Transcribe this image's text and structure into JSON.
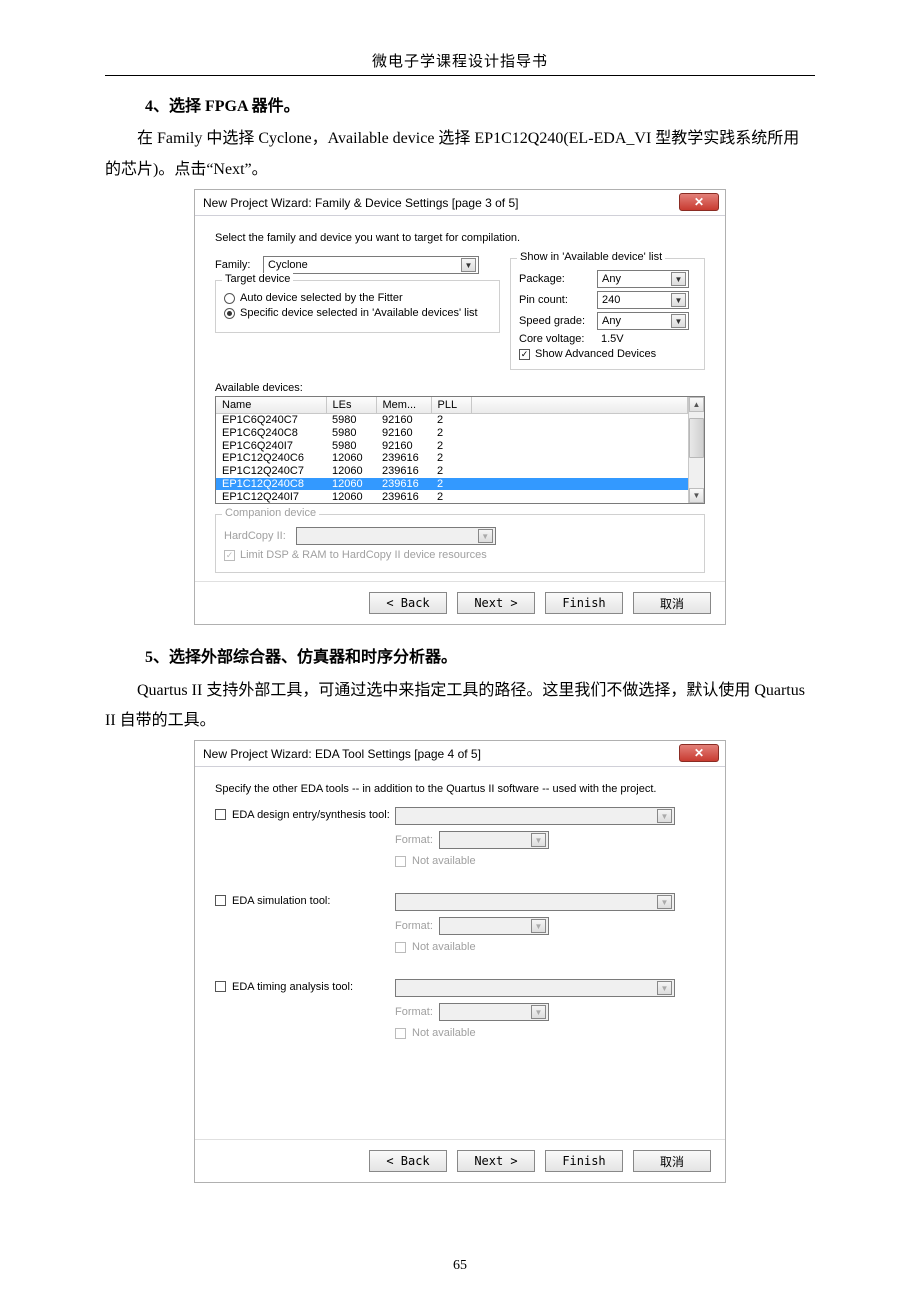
{
  "header": "微电子学课程设计指导书",
  "step4": {
    "label": "4、选择 FPGA 器件。"
  },
  "para1": "在 Family 中选择 Cyclone，Available device 选择 EP1C12Q240(EL-EDA_VI 型教学实践系统所用的芯片)。点击“Next”。",
  "step5": {
    "label": "5、选择外部综合器、仿真器和时序分析器。"
  },
  "para2": "Quartus II 支持外部工具，可通过选中来指定工具的路径。这里我们不做选择，默认使用 Quartus II 自带的工具。",
  "page_number": "65",
  "dialog1": {
    "title": "New Project Wizard: Family & Device Settings [page 3 of 5]",
    "instruction": "Select the family and device you want to target for compilation.",
    "family_label": "Family:",
    "family_value": "Cyclone",
    "target_legend": "Target device",
    "radio_auto": "Auto device selected by the Fitter",
    "radio_specific": "Specific device selected in 'Available devices' list",
    "show_legend": "Show in 'Available device' list",
    "package_label": "Package:",
    "package_value": "Any",
    "pincount_label": "Pin count:",
    "pincount_value": "240",
    "speed_label": "Speed grade:",
    "speed_value": "Any",
    "core_label": "Core voltage:",
    "core_value": "1.5V",
    "adv_label": "Show Advanced Devices",
    "avail_label": "Available devices:",
    "cols": {
      "name": "Name",
      "les": "LEs",
      "mem": "Mem...",
      "pll": "PLL"
    },
    "rows": [
      {
        "name": "EP1C6Q240C7",
        "les": "5980",
        "mem": "92160",
        "pll": "2"
      },
      {
        "name": "EP1C6Q240C8",
        "les": "5980",
        "mem": "92160",
        "pll": "2"
      },
      {
        "name": "EP1C6Q240I7",
        "les": "5980",
        "mem": "92160",
        "pll": "2"
      },
      {
        "name": "EP1C12Q240C6",
        "les": "12060",
        "mem": "239616",
        "pll": "2"
      },
      {
        "name": "EP1C12Q240C7",
        "les": "12060",
        "mem": "239616",
        "pll": "2"
      },
      {
        "name": "EP1C12Q240C8",
        "les": "12060",
        "mem": "239616",
        "pll": "2"
      },
      {
        "name": "EP1C12Q240I7",
        "les": "12060",
        "mem": "239616",
        "pll": "2"
      }
    ],
    "selected_index": 5,
    "companion_legend": "Companion device",
    "hardcopy_label": "HardCopy II:",
    "limit_label": "Limit DSP & RAM to HardCopy II device resources",
    "btn_back": "< Back",
    "btn_next": "Next >",
    "btn_finish": "Finish",
    "btn_cancel": "取消"
  },
  "dialog2": {
    "title": "New Project Wizard: EDA Tool Settings [page 4 of 5]",
    "instruction": "Specify the other EDA tools -- in addition to the Quartus II software -- used with the project.",
    "tool1": "EDA design entry/synthesis tool:",
    "tool2": "EDA simulation tool:",
    "tool3": "EDA timing analysis tool:",
    "format_label": "Format:",
    "notavail_label": "Not available",
    "btn_back": "< Back",
    "btn_next": "Next >",
    "btn_finish": "Finish",
    "btn_cancel": "取消"
  }
}
